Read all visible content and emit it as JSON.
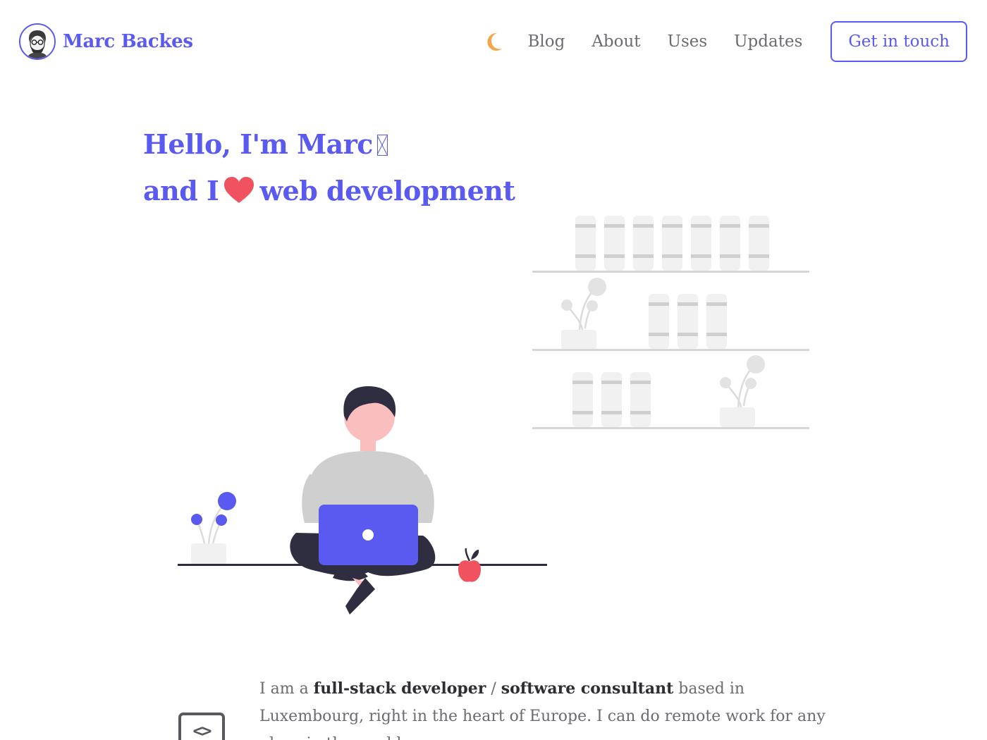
{
  "header": {
    "brand_name": "Marc Backes",
    "theme_toggle_icon": "moon-icon",
    "nav": [
      {
        "label": "Blog"
      },
      {
        "label": "About"
      },
      {
        "label": "Uses"
      },
      {
        "label": "Updates"
      }
    ],
    "cta_label": "Get in touch"
  },
  "hero": {
    "line1": "Hello, I'm Marc",
    "line1_glyph": "missing-glyph-box",
    "line2_prefix": "and I",
    "line2_icon": "heart-icon",
    "line2_suffix": "web development"
  },
  "about": {
    "icon": "code-brackets-icon",
    "icon_glyph": "<>",
    "p1_a": "I am a ",
    "p1_b": "full-stack developer",
    "p1_c": " / ",
    "p1_d": "software consultant",
    "p1_e": " based in Luxembourg, right in the heart of Europe. I can do remote work for any place in the world."
  },
  "colors": {
    "accent": "#5a5af0",
    "moon": "#f5a54a",
    "heart": "#f0525f",
    "nav_text": "#6b6b70",
    "shelf_gray": "#e0e0e0"
  }
}
